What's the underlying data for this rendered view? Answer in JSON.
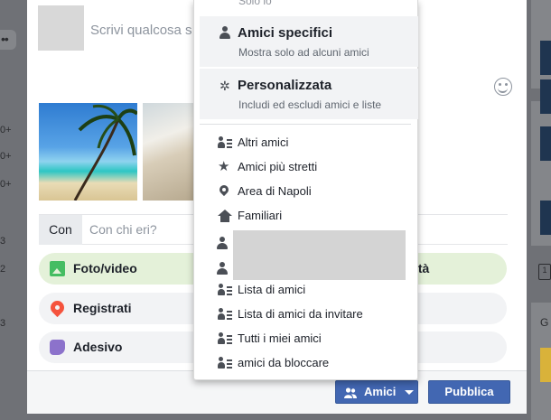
{
  "background": {
    "left_numbers": [
      "0+",
      "0+",
      "0+",
      "3",
      "2",
      "3"
    ],
    "right_letter": "G",
    "calendar_glyph": "1"
  },
  "composer": {
    "placeholder": "Scrivi qualcosa s",
    "tag_label": "Con",
    "tag_placeholder": "Con chi eri?",
    "actions": [
      {
        "label": "Foto/video",
        "icon": "photo-icon"
      },
      {
        "label": "Registrati",
        "icon": "location-pin-icon"
      },
      {
        "label": "Adesivo",
        "icon": "sticker-icon"
      }
    ],
    "hidden_action_suffix": "ità",
    "emoji_icon": "smiley-icon"
  },
  "footer": {
    "audience_button": "Amici",
    "publish_button": "Pubblica"
  },
  "privacy_menu": {
    "top_cut_text": "Solo io",
    "options": [
      {
        "title": "Amici specifici",
        "subtitle": "Mostra solo ad alcuni amici",
        "icon": "person-icon"
      },
      {
        "title": "Personalizzata",
        "subtitle": "Includi ed escludi amici e liste",
        "icon": "gear-icon"
      }
    ],
    "lists_top": [
      {
        "label": "Altri amici",
        "icon": "friend-list-icon"
      },
      {
        "label": "Amici più stretti",
        "icon": "star-icon"
      },
      {
        "label": "Area di Napoli",
        "icon": "location-pin-icon"
      },
      {
        "label": "Familiari",
        "icon": "house-icon"
      }
    ],
    "lists_bottom": [
      {
        "label": "Lista di amici",
        "icon": "friend-list-icon"
      },
      {
        "label": "Lista di amici da invitare",
        "icon": "friend-list-icon"
      },
      {
        "label": "Tutti i miei amici",
        "icon": "friend-list-icon"
      },
      {
        "label": "amici da bloccare",
        "icon": "friend-list-icon"
      }
    ]
  },
  "colors": {
    "brand_blue": "#4267b2",
    "photo_green": "#45bd62",
    "checkin_red": "#f5533d",
    "sticker_purple": "#8c72cb"
  }
}
